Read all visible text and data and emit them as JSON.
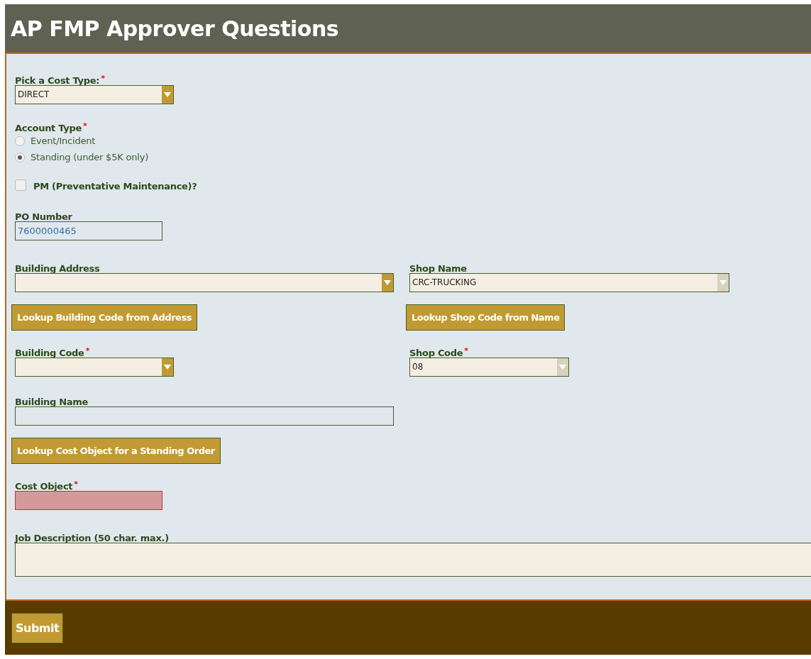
{
  "title": "AP FMP Approver Questions",
  "cost_type": {
    "label": "Pick a Cost Type:",
    "required_mark": "*",
    "value": "DIRECT",
    "disabled": false
  },
  "account_type": {
    "label": "Account Type",
    "required_mark": "*",
    "options": [
      {
        "label": "Event/Incident",
        "selected": false
      },
      {
        "label": "Standing (under $5K only)",
        "selected": true
      }
    ]
  },
  "pm": {
    "label": "PM (Preventative Maintenance)?",
    "checked": false
  },
  "po_number": {
    "label": "PO Number",
    "value": "7600000465"
  },
  "building_address": {
    "label": "Building Address",
    "disabled": false
  },
  "shop_name": {
    "label": "Shop Name",
    "value": "CRC-TRUCKING",
    "disabled": true
  },
  "lookup_building_button": "Lookup Building Code from Address",
  "lookup_shop_button": "Lookup Shop Code from Name",
  "building_code": {
    "label": "Building Code",
    "required_mark": "*",
    "disabled": false
  },
  "shop_code": {
    "label": "Shop Code",
    "required_mark": "*",
    "value": "08",
    "disabled": true
  },
  "building_name": {
    "label": "Building Name"
  },
  "lookup_cost_button": "Lookup Cost Object for a Standing Order",
  "cost_object": {
    "label": "Cost Object",
    "required_mark": "*",
    "invalid": true
  },
  "job_description": {
    "label": "Job Description (50 char. max.)"
  },
  "submit": "Submit"
}
